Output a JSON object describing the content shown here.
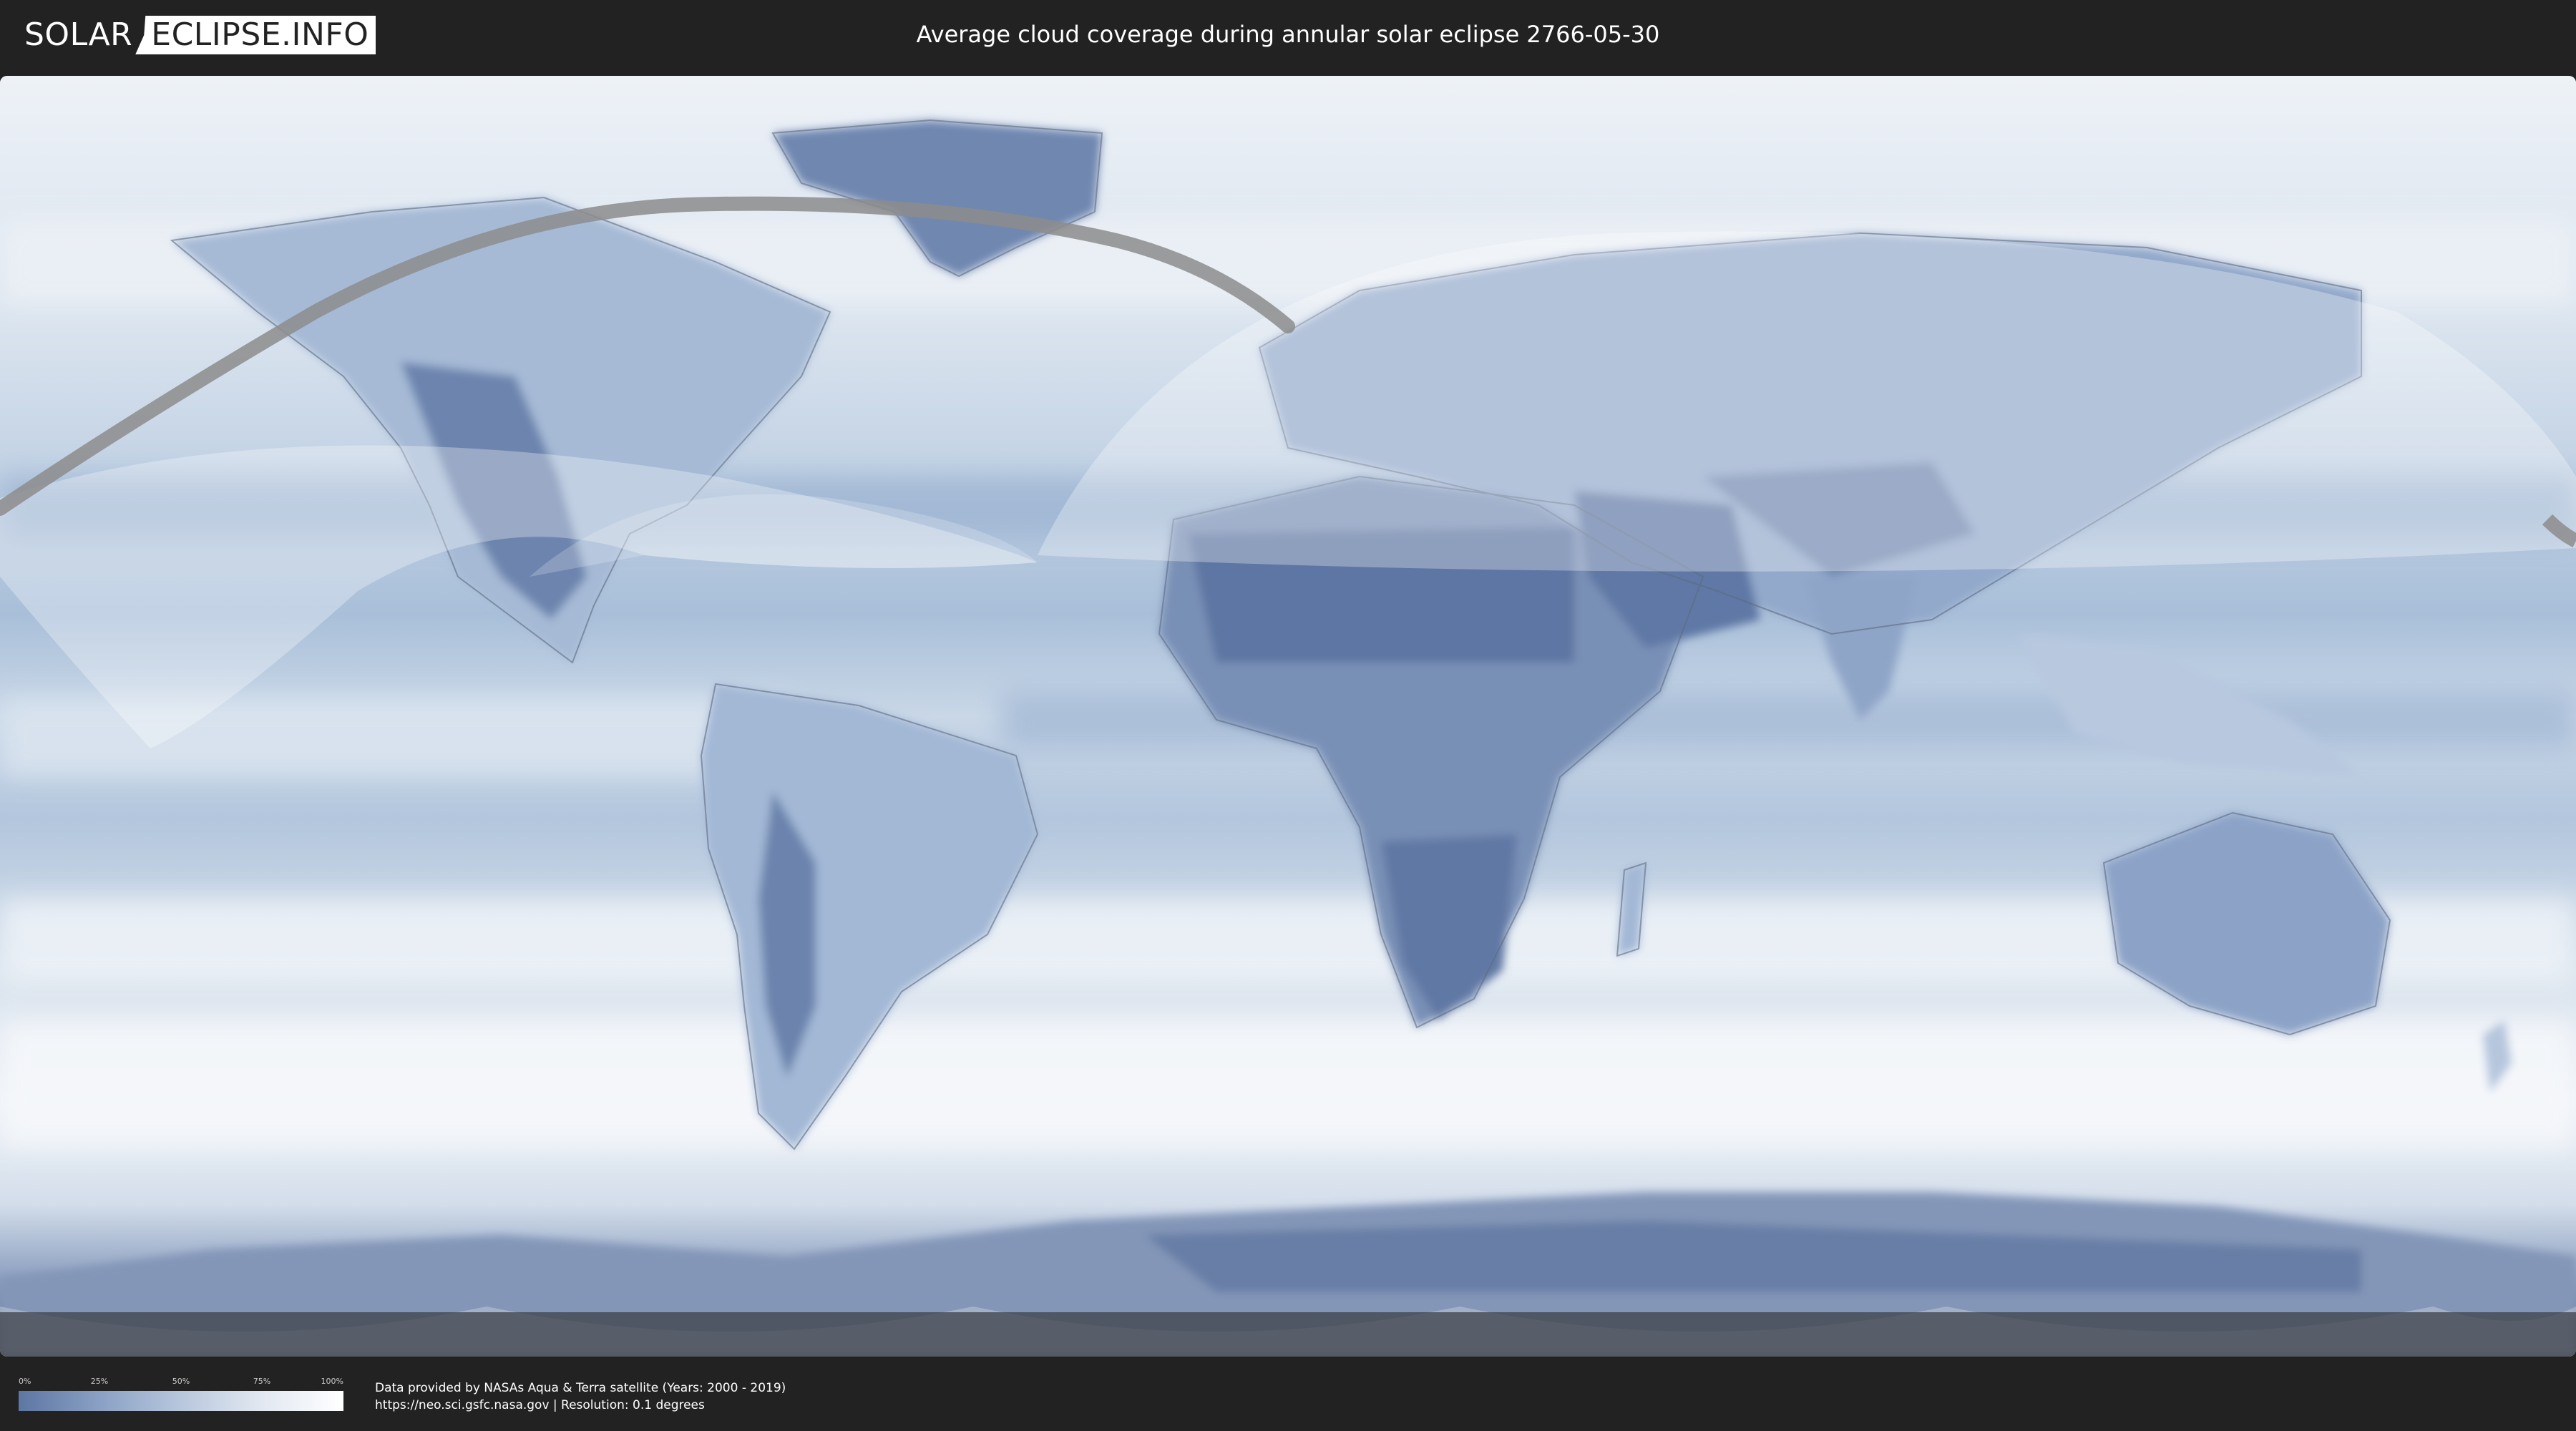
{
  "header": {
    "logo_left": "SOLAR",
    "logo_right": "ECLIPSE.INFO",
    "title": "Average cloud coverage during annular solar eclipse 2766-05-30"
  },
  "map": {
    "projection": "equirectangular",
    "layers": [
      "cloud-coverage-raster",
      "country-borders",
      "eclipse-visibility-zone",
      "annularity-path"
    ],
    "colors": {
      "clear_sky": "#5d76a3",
      "overcast": "#ffffff",
      "eclipse_path": "#8c8c8c",
      "visibility_shade": "#ffffff"
    }
  },
  "legend": {
    "ticks": [
      "0%",
      "25%",
      "50%",
      "75%",
      "100%"
    ]
  },
  "footer": {
    "credit_line1": "Data provided by NASAs Aqua & Terra satellite (Years: 2000 - 2019)",
    "credit_line2": "https://neo.sci.gsfc.nasa.gov | Resolution: 0.1 degrees"
  }
}
